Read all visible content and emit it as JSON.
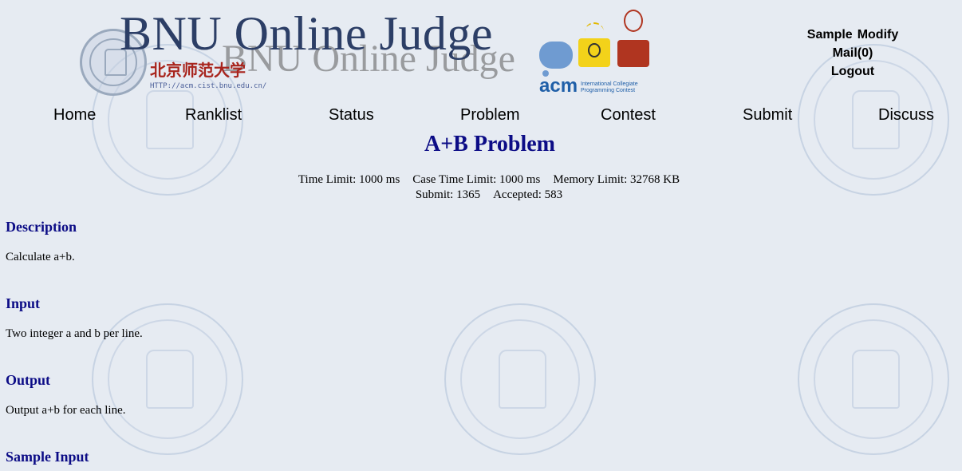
{
  "header": {
    "site_title": "BNU Online Judge",
    "university_name": "北京师范大学",
    "university_url": "HTTP://acm.cist.bnu.edu.cn/",
    "acm_word": "acm",
    "acm_subtitle": "International Collegiate Programming Contest",
    "user": {
      "username": "Sample",
      "modify": "Modify",
      "mail": "Mail(0)",
      "logout": "Logout"
    }
  },
  "nav": {
    "home": "Home",
    "ranklist": "Ranklist",
    "status": "Status",
    "problem": "Problem",
    "contest": "Contest",
    "submit": "Submit",
    "discuss": "Discuss"
  },
  "problem": {
    "title": "A+B Problem",
    "time_limit": "Time Limit: 1000 ms",
    "case_time_limit": "Case Time Limit: 1000 ms",
    "memory_limit": "Memory Limit: 32768 KB",
    "submit": "Submit: 1365",
    "accepted": "Accepted: 583",
    "sections": {
      "description": {
        "title": "Description",
        "text": "Calculate a+b."
      },
      "input": {
        "title": "Input",
        "text": "Two integer a and b per line."
      },
      "output": {
        "title": "Output",
        "text": "Output a+b for each line."
      },
      "sample_input": {
        "title": "Sample Input"
      }
    }
  },
  "colors": {
    "background": "#e6ebf2",
    "heading": "#0c0c86",
    "site_title": "#2c3e66",
    "university_red": "#a8241c",
    "acm_blue": "#1f5fa8"
  }
}
